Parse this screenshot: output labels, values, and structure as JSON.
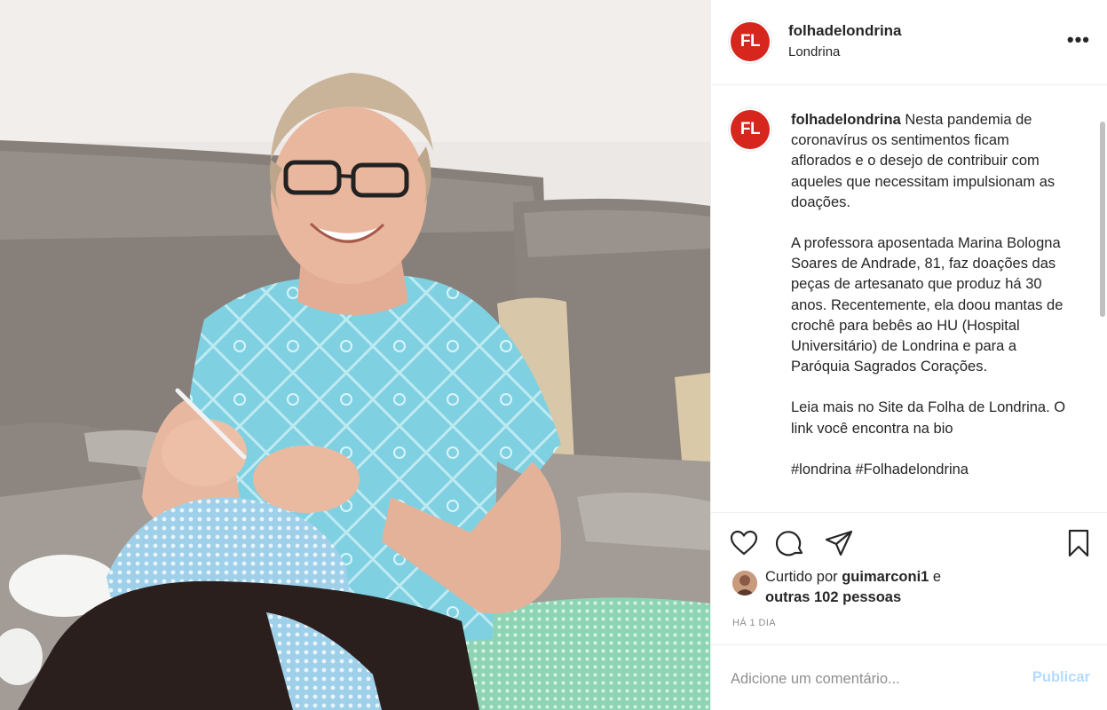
{
  "header": {
    "avatar_text": "FL",
    "username": "folhadelondrina",
    "location": "Londrina",
    "more_label": "•••"
  },
  "caption": {
    "avatar_text": "FL",
    "username": "folhadelondrina",
    "paragraphs": [
      "Nesta pandemia de coronavírus os sentimentos ficam aflorados e o desejo de contribuir com aqueles que necessitam impulsionam as doações.",
      "A professora aposentada Marina Bologna Soares de Andrade, 81, faz doações das peças de artesanato que produz há 30 anos. Recentemente, ela doou mantas de crochê para bebês ao HU (Hospital Universitário) de Londrina e para a Paróquia Sagrados Corações.",
      "Leia mais no Site da Folha de Londrina. O link você encontra na bio",
      "#londrina #Folhadelondrina"
    ]
  },
  "actions": {
    "icons": [
      "heart-icon",
      "comment-bubble-icon",
      "paper-plane-icon",
      "bookmark-icon"
    ]
  },
  "likes": {
    "prefix": "Curtido por ",
    "liker": "guimarconi1",
    "suffix": " e",
    "others": "outras 102 pessoas"
  },
  "timestamp": "HÁ 1 DIA",
  "comment_form": {
    "placeholder": "Adicione um comentário...",
    "publish_label": "Publicar"
  },
  "colors": {
    "brand_red": "#d7261e",
    "publish_disabled": "#b3dbff",
    "muted": "#8e8e8e"
  }
}
